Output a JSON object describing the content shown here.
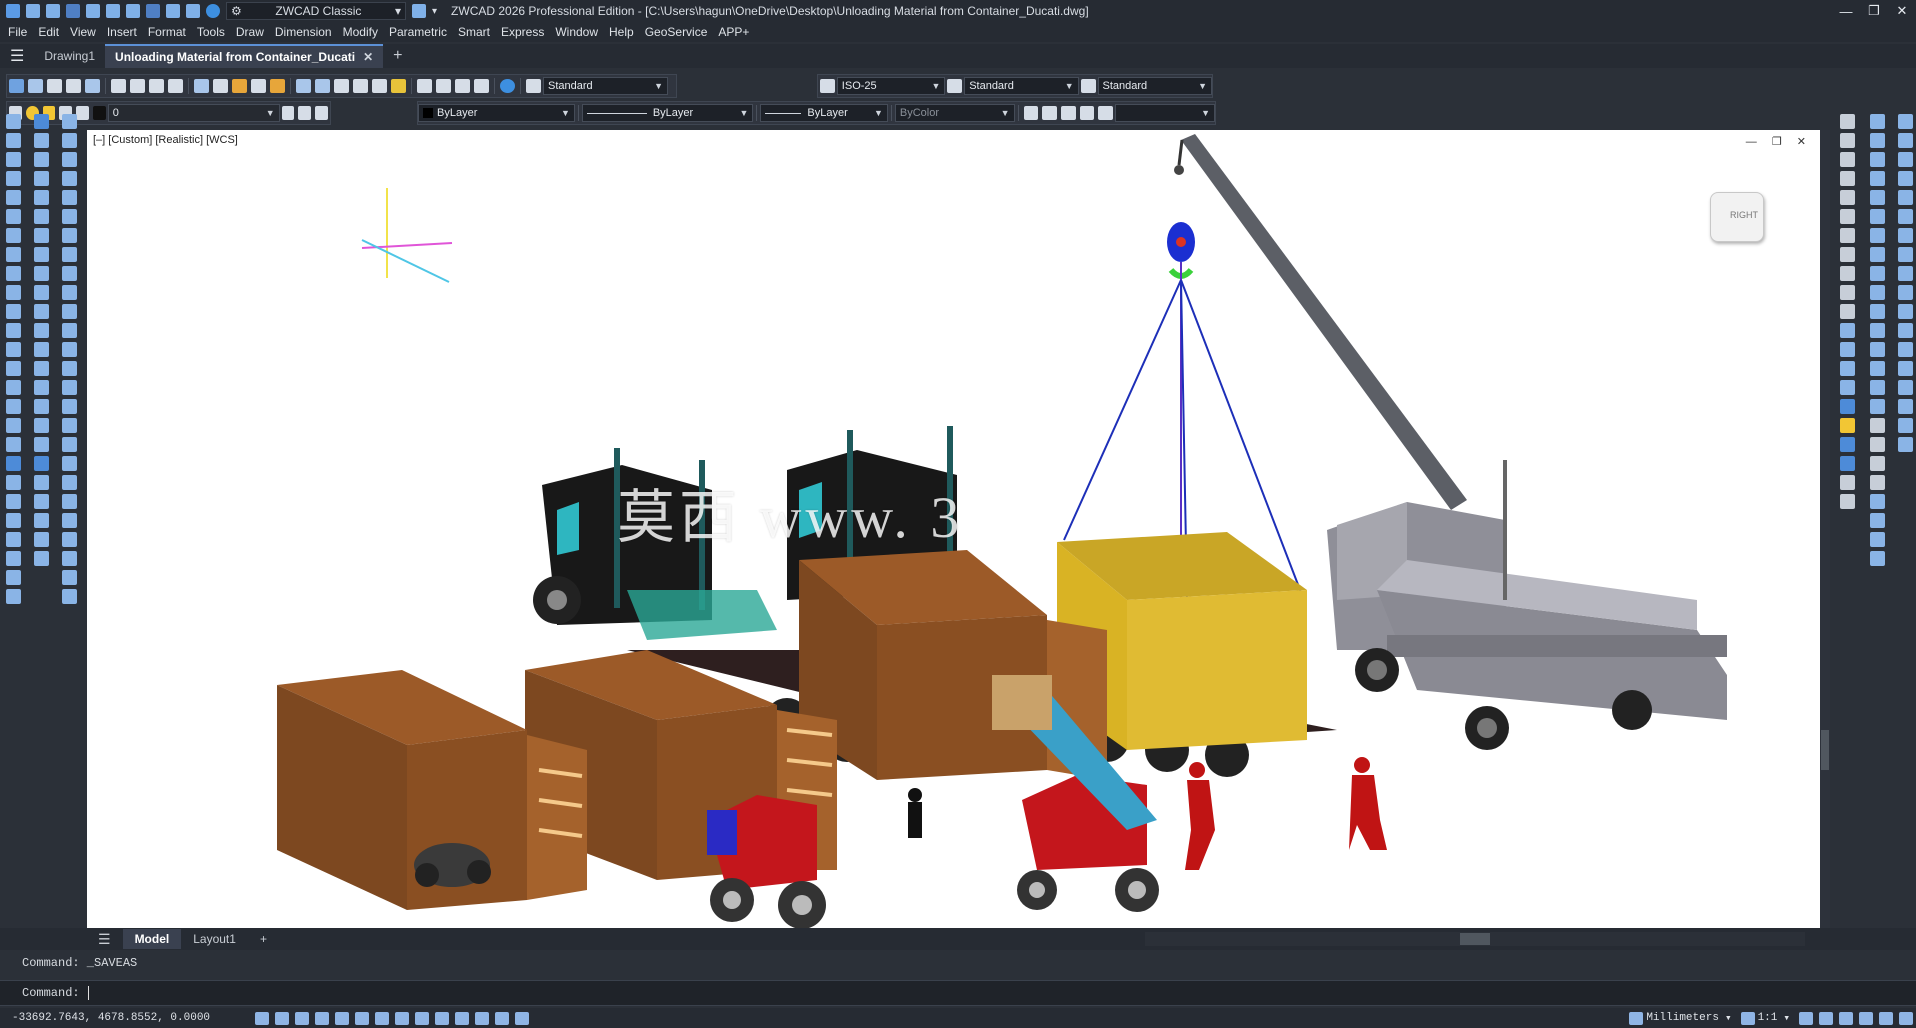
{
  "title_bar": {
    "workspace": "ZWCAD Classic",
    "title": "ZWCAD 2026 Professional Edition - [C:\\Users\\hagun\\OneDrive\\Desktop\\Unloading Material from Container_Ducati.dwg]",
    "window_controls": [
      "—",
      "❐",
      "✕"
    ]
  },
  "menu": [
    "File",
    "Edit",
    "View",
    "Insert",
    "Format",
    "Tools",
    "Draw",
    "Dimension",
    "Modify",
    "Parametric",
    "Smart",
    "Express",
    "Window",
    "Help",
    "GeoService",
    "APP+"
  ],
  "doc_tabs": {
    "tab1": "Drawing1",
    "tab2": "Unloading Material from Container_Ducati",
    "close": "✕",
    "add": "+"
  },
  "styles_toolbar": {
    "text_style": "Standard",
    "dim_style": "ISO-25",
    "table_style": "Standard",
    "multileader_style": "Standard"
  },
  "layers_toolbar": {
    "layer": "0",
    "color": "ByLayer",
    "linetype": "ByLayer",
    "lineweight": "ByLayer",
    "plotstyle": "ByColor"
  },
  "viewport": {
    "label": "[–] [Custom] [Realistic] [WCS]",
    "controls": "— ❐ ✕",
    "viewcube_label": "RIGHT",
    "watermark": "莫西 www. 3"
  },
  "layout_tabs": {
    "menu": "☰",
    "model": "Model",
    "layout1": "Layout1",
    "add": "+"
  },
  "command": {
    "history": "Command:  _SAVEAS",
    "prompt": "Command:"
  },
  "status": {
    "coords": "-33692.7643, 4678.8552, 0.0000",
    "units": "Millimeters",
    "scale": "1:1"
  },
  "colors": {
    "container_brown": "#8a4f22",
    "container_yellow": "#d9b324",
    "truck_grey": "#8f8f98",
    "forklift_red": "#c4161c",
    "boom_grey": "#5c5f66"
  }
}
